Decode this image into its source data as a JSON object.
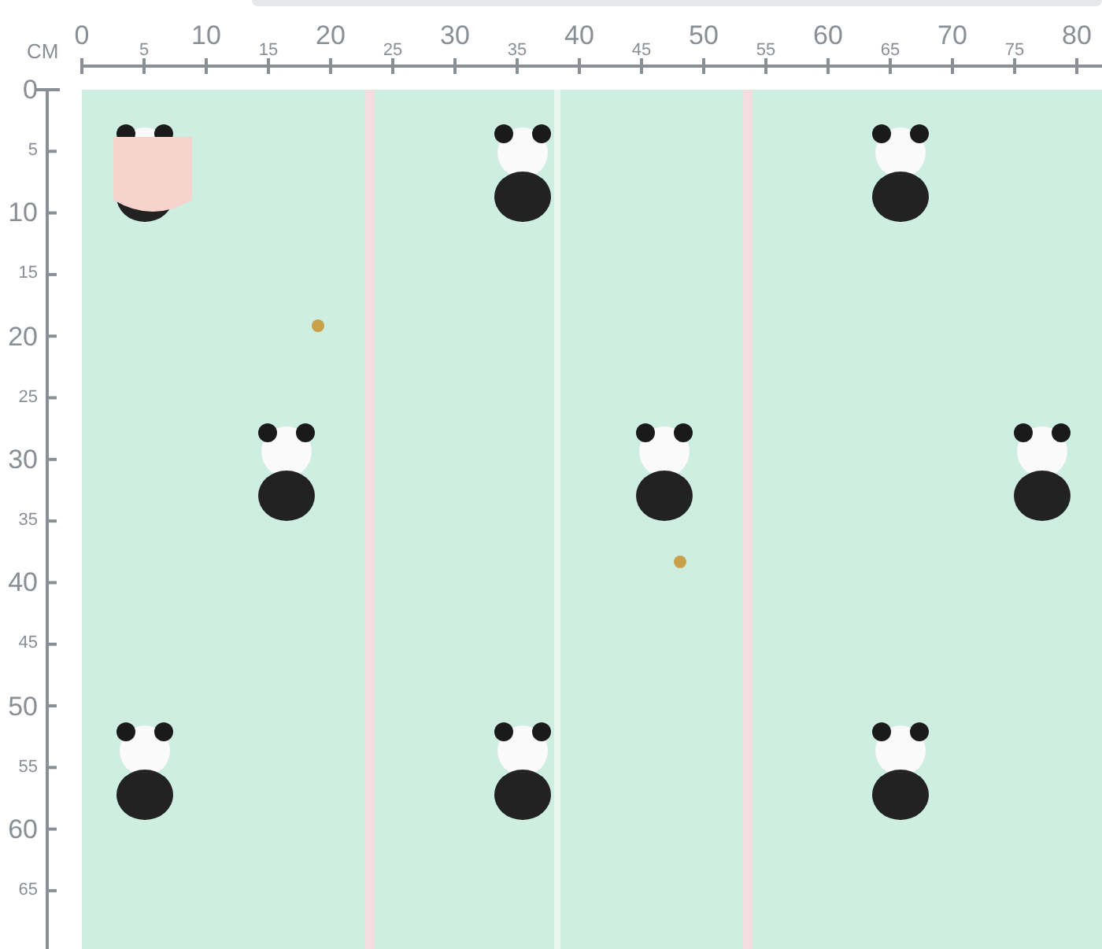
{
  "ruler": {
    "unit": "CM",
    "top_labels": [
      {
        "text": "0",
        "kind": "major"
      },
      {
        "text": "5",
        "kind": "minor"
      },
      {
        "text": "10",
        "kind": "major"
      },
      {
        "text": "15",
        "kind": "minor"
      },
      {
        "text": "20",
        "kind": "major"
      },
      {
        "text": "25",
        "kind": "minor"
      },
      {
        "text": "30",
        "kind": "major"
      },
      {
        "text": "35",
        "kind": "minor"
      },
      {
        "text": "40",
        "kind": "major"
      },
      {
        "text": "45",
        "kind": "minor"
      },
      {
        "text": "50",
        "kind": "major"
      },
      {
        "text": "55",
        "kind": "minor"
      },
      {
        "text": "60",
        "kind": "major"
      },
      {
        "text": "65",
        "kind": "minor"
      },
      {
        "text": "70",
        "kind": "major"
      },
      {
        "text": "75",
        "kind": "minor"
      },
      {
        "text": "80",
        "kind": "major"
      }
    ],
    "left_labels": [
      {
        "text": "0",
        "kind": "major"
      },
      {
        "text": "5",
        "kind": "minor"
      },
      {
        "text": "10",
        "kind": "major"
      },
      {
        "text": "15",
        "kind": "minor"
      },
      {
        "text": "20",
        "kind": "major"
      },
      {
        "text": "25",
        "kind": "minor"
      },
      {
        "text": "30",
        "kind": "major"
      },
      {
        "text": "35",
        "kind": "minor"
      },
      {
        "text": "40",
        "kind": "major"
      },
      {
        "text": "45",
        "kind": "minor"
      },
      {
        "text": "50",
        "kind": "major"
      },
      {
        "text": "55",
        "kind": "minor"
      },
      {
        "text": "60",
        "kind": "major"
      },
      {
        "text": "65",
        "kind": "minor"
      }
    ]
  }
}
